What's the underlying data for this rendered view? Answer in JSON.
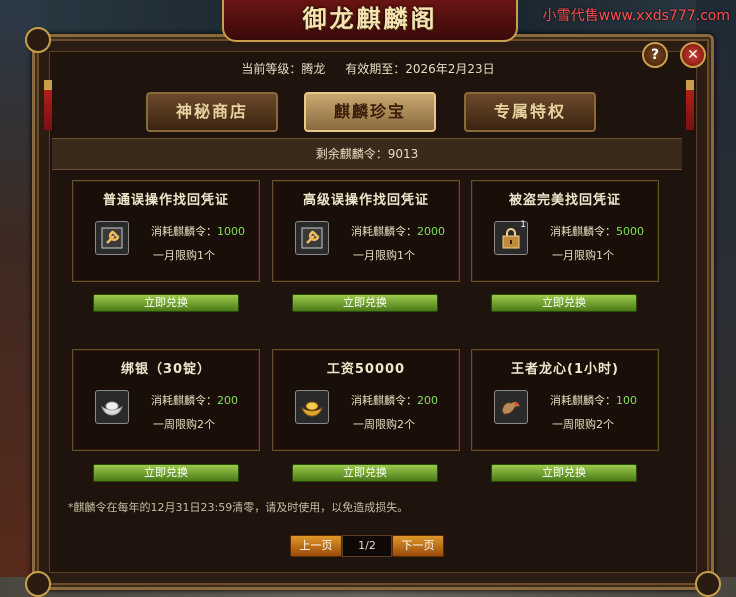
{
  "watermark": "小雪代售www.xxds777.com",
  "window": {
    "title": "御龙麒麟阁",
    "help_label": "?",
    "close_label": "✕"
  },
  "status": {
    "level_label": "当前等级：",
    "level_value": "腾龙",
    "expiry_label": "有效期至：",
    "expiry_value": "2026年2月23日"
  },
  "tabs": [
    {
      "label": "神秘商店",
      "active": false
    },
    {
      "label": "麒麟珍宝",
      "active": true
    },
    {
      "label": "专属特权",
      "active": false
    }
  ],
  "remaining": {
    "label": "剩余麒麟令：",
    "value": "9013"
  },
  "items": [
    {
      "title": "普通误操作找回凭证",
      "icon": "wrench-icon",
      "cost_label": "消耗麒麟令：",
      "cost": "1000",
      "limit": "一月限购1个",
      "button": "立即兑换"
    },
    {
      "title": "高级误操作找回凭证",
      "icon": "wrench-icon",
      "cost_label": "消耗麒麟令：",
      "cost": "2000",
      "limit": "一月限购1个",
      "button": "立即兑换"
    },
    {
      "title": "被盗完美找回凭证",
      "icon": "lock-icon",
      "icon_badge": "1",
      "cost_label": "消耗麒麟令：",
      "cost": "5000",
      "limit": "一月限购1个",
      "button": "立即兑换"
    },
    {
      "title": "绑银（30锭）",
      "icon": "silver-ingot-icon",
      "cost_label": "消耗麒麟令：",
      "cost": "200",
      "limit": "一周限购2个",
      "button": "立即兑换"
    },
    {
      "title": "工资50000",
      "icon": "gold-ingot-icon",
      "cost_label": "消耗麒麟令：",
      "cost": "200",
      "limit": "一周限购2个",
      "button": "立即兑换"
    },
    {
      "title": "王者龙心(1小时)",
      "icon": "dragon-heart-icon",
      "cost_label": "消耗麒麟令：",
      "cost": "100",
      "limit": "一周限购2个",
      "button": "立即兑换"
    }
  ],
  "notice": "*麒麟令在每年的12月31日23:59清零，请及时使用，以免造成损失。",
  "pagination": {
    "prev": "上一页",
    "current": "1/2",
    "next": "下一页"
  },
  "colors": {
    "accent_gold": "#c9a04a",
    "cost_green": "#7fe05a",
    "button_green": "#6aa02a",
    "page_button_orange": "#d0781a"
  }
}
